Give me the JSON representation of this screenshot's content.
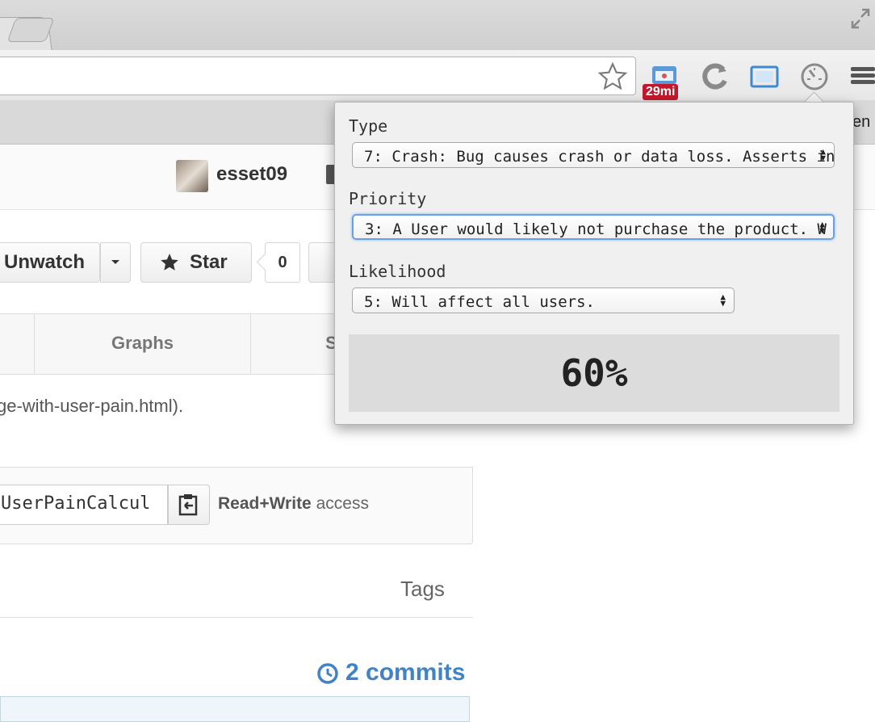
{
  "browser": {
    "extension_badge": "29mi",
    "bookmark_partial_label": "en"
  },
  "page": {
    "username": "esset09",
    "actions": {
      "unwatch_label": "Unwatch",
      "star_label": "Star",
      "star_count": "0"
    },
    "nav_tabs": [
      {
        "label": "Graphs"
      },
      {
        "label": "S"
      }
    ],
    "description_fragment": "ge-with-user-pain.html).",
    "clone": {
      "url_value": "UserPainCalcul",
      "access_bold": "Read+Write",
      "access_text": " access"
    },
    "tags_label": "Tags",
    "commits_label": "2 commits"
  },
  "popup": {
    "type_label": "Type",
    "type_value": "7: Crash: Bug causes crash or data loss. Asserts in",
    "priority_label": "Priority",
    "priority_value": "3: A User would likely not purchase the product. W",
    "likelihood_label": "Likelihood",
    "likelihood_value": "5: Will affect all users.",
    "result": "60%"
  },
  "colors": {
    "link_blue": "#4183c4",
    "badge_red": "#c2182b",
    "focus_ring": "#6aa1e6"
  }
}
